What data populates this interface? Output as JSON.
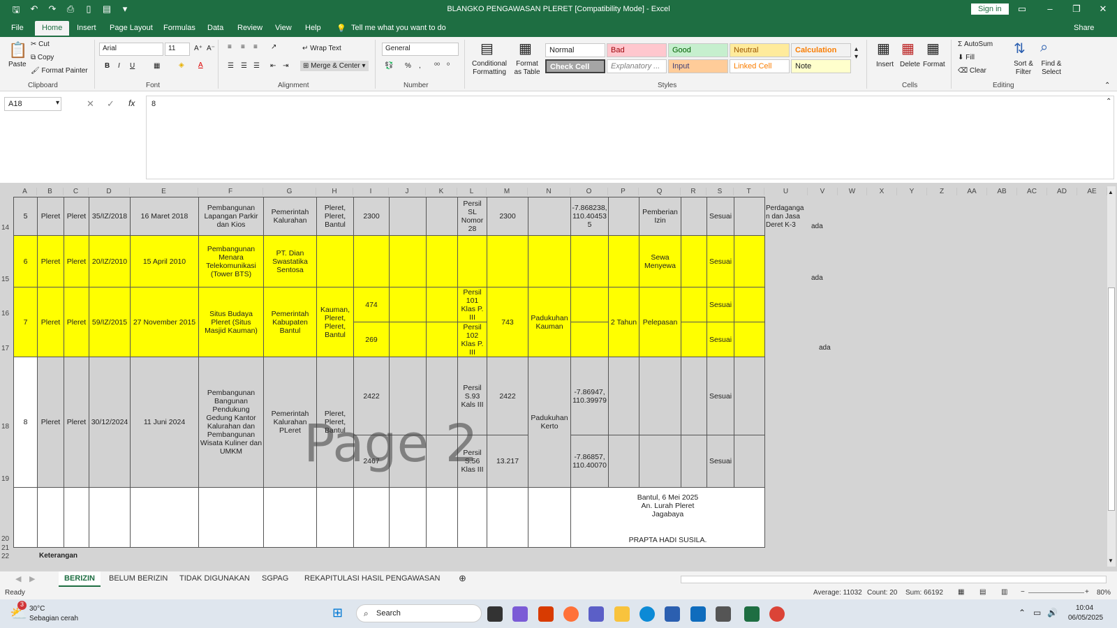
{
  "titlebar": {
    "title": "BLANGKO PENGAWASAN PLERET  [Compatibility Mode]  -  Excel",
    "signin": "Sign in"
  },
  "tabs": [
    "File",
    "Home",
    "Insert",
    "Page Layout",
    "Formulas",
    "Data",
    "Review",
    "View",
    "Help"
  ],
  "tell": "Tell me what you want to do",
  "share": "Share",
  "ribbon": {
    "clipboard": {
      "paste": "Paste",
      "cut": "Cut",
      "copy": "Copy",
      "painter": "Format Painter",
      "label": "Clipboard"
    },
    "font": {
      "name": "Arial",
      "size": "11",
      "label": "Font"
    },
    "alignment": {
      "wrap": "Wrap Text",
      "merge": "Merge & Center",
      "label": "Alignment"
    },
    "number": {
      "format": "General",
      "label": "Number"
    },
    "styles": {
      "cond": "Conditional Formatting",
      "fmt_table": "Format as Table",
      "normal": "Normal",
      "bad": "Bad",
      "good": "Good",
      "neutral": "Neutral",
      "calculation": "Calculation",
      "check": "Check Cell",
      "explanatory": "Explanatory ...",
      "input": "Input",
      "linked": "Linked Cell",
      "note": "Note",
      "label": "Styles"
    },
    "cells": {
      "insert": "Insert",
      "delete": "Delete",
      "format": "Format",
      "label": "Cells"
    },
    "editing": {
      "autosum": "AutoSum",
      "fill": "Fill",
      "clear": "Clear",
      "sort": "Sort & Filter",
      "find": "Find & Select",
      "label": "Editing"
    }
  },
  "namebox": "A18",
  "formula": "8",
  "columns": [
    "A",
    "B",
    "C",
    "D",
    "E",
    "F",
    "G",
    "H",
    "I",
    "J",
    "K",
    "L",
    "M",
    "N",
    "O",
    "P",
    "Q",
    "R",
    "S",
    "T",
    "U",
    "V",
    "W",
    "X",
    "Y",
    "Z",
    "AA",
    "AB",
    "AC",
    "AD",
    "AE"
  ],
  "rownums": [
    "14",
    "15",
    "16",
    "17",
    "18",
    "19",
    "20",
    "21",
    "22"
  ],
  "rows": {
    "r14": {
      "a": "5",
      "b": "Pleret",
      "c": "Pleret",
      "d": "35/IZ/2018",
      "e": "16 Maret 2018",
      "f": "Pembangunan Lapangan Parkir dan Kios",
      "g": "Pemerintah Kalurahan",
      "h": "Pleret, Pleret, Bantul",
      "i": "2300",
      "l": "Persil SL Nomor 28",
      "m": "2300",
      "o": "-7.868238, 110.40453 5",
      "q": "Pemberian Izin",
      "s": "Sesuai",
      "u": "Perdaganga n dan Jasa Deret K-3",
      "v": "ada"
    },
    "r15": {
      "a": "6",
      "b": "Pleret",
      "c": "Pleret",
      "d": "20/IZ/2010",
      "e": "15 April 2010",
      "f": "Pembangunan Menara Telekomunikasi (Tower BTS)",
      "g": "PT. Dian Swastatika Sentosa",
      "q": "Sewa Menyewa",
      "s": "Sesuai",
      "v": "ada"
    },
    "r16": {
      "a": "7",
      "b": "Pleret",
      "c": "Pleret",
      "d": "59/IZ/2015",
      "e": "27 November 2015",
      "f": "Situs Budaya Pleret (Situs Masjid Kauman)",
      "g": "Pemerintah Kabupaten Bantul",
      "h": "Kauman, Pleret, Pleret, Bantul",
      "i": "474",
      "l": "Persil 101 Klas P. III",
      "m": "743",
      "n": "Padukuhan Kauman",
      "p": "2 Tahun",
      "q": "Pelepasan",
      "s": "Sesuai"
    },
    "r17": {
      "i": "269",
      "l": "Persil 102 Klas P. III",
      "s": "Sesuai",
      "v": "ada"
    },
    "r18": {
      "a": "8",
      "b": "Pleret",
      "c": "Pleret",
      "d": "30/12/2024",
      "e": "11 Juni 2024",
      "f": "Pembangunan Bangunan Pendukung Gedung Kantor Kalurahan  dan Pembangunan Wisata Kuliner dan UMKM",
      "g": "Pemerintah Kalurahan PLeret",
      "h": "Pleret, Pleret, Bantul",
      "i": "2422",
      "l": "Persil S.93 Kals III",
      "m": "2422",
      "n": "Padukuhan Kerto",
      "o": "-7.86947, 110.39979",
      "s": "Sesuai"
    },
    "r19": {
      "i": "2467",
      "l": "Persil S.56 Klas III",
      "m": "13.217",
      "o": "-7.86857, 110.40070",
      "s": "Sesuai"
    },
    "r20": {
      "sign1": "Bantul, 6 Mei 2025",
      "sign2": "An. Lurah Pleret",
      "sign3": "Jagabaya",
      "sign4": "PRAPTA HADI SUSILA."
    },
    "r22": {
      "b": "Keterangan"
    }
  },
  "watermark": "Page 2",
  "sheets": [
    "BERIZIN",
    "BELUM BERIZIN",
    "TIDAK DIGUNAKAN",
    "SGPAG",
    "REKAPITULASI HASIL PENGAWASAN"
  ],
  "status": {
    "ready": "Ready",
    "average": "Average: 11032",
    "count": "Count: 20",
    "sum": "Sum: 66192",
    "zoom": "80%"
  },
  "taskbar": {
    "temp": "30°C",
    "weather": "Sebagian cerah",
    "badge": "3",
    "search": "Search",
    "time": "10:04",
    "date": "06/05/2025"
  }
}
